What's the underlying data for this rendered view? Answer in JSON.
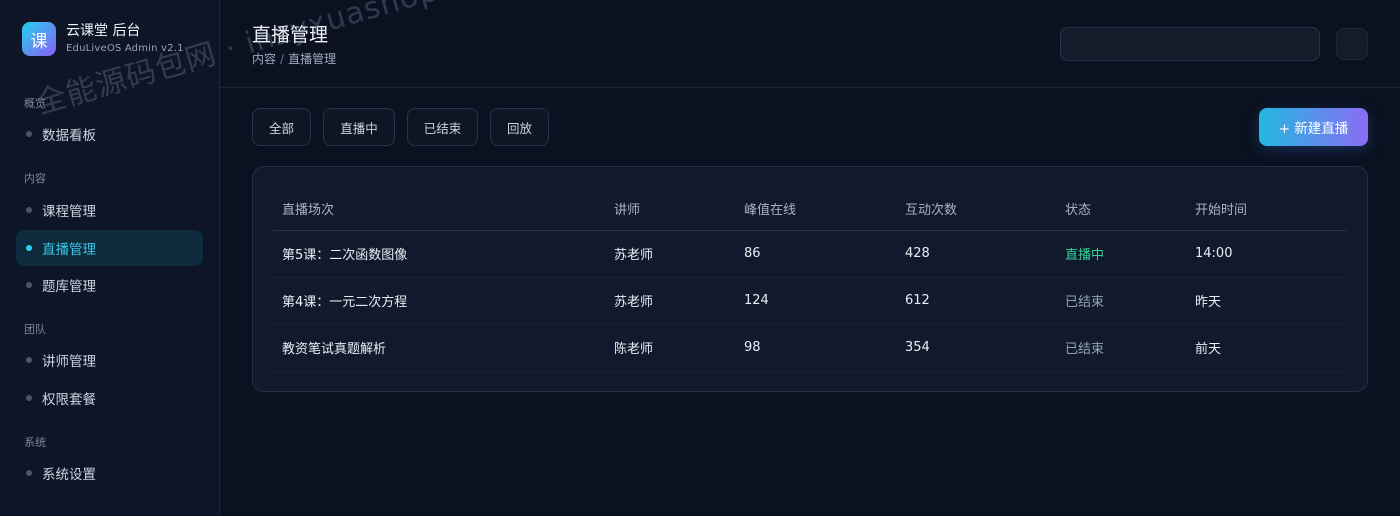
{
  "brand": {
    "logo_char": "课",
    "name": "云课堂 后台",
    "subtitle": "EduLiveOS Admin v2.1"
  },
  "sidebar": {
    "sections": [
      {
        "label": "概览"
      },
      {
        "label": "内容"
      },
      {
        "label": "团队"
      },
      {
        "label": "系统"
      }
    ],
    "items": [
      {
        "label": "数据看板",
        "active": false
      },
      {
        "label": "课程管理",
        "active": false
      },
      {
        "label": "直播管理",
        "active": true
      },
      {
        "label": "题库管理",
        "active": false
      },
      {
        "label": "讲师管理",
        "active": false
      },
      {
        "label": "权限套餐",
        "active": false
      },
      {
        "label": "系统设置",
        "active": false
      }
    ]
  },
  "header": {
    "title": "直播管理",
    "breadcrumb": [
      "内容",
      "直播管理"
    ],
    "breadcrumb_separator": "/",
    "search_value": ""
  },
  "filters": [
    "全部",
    "直播中",
    "已结束",
    "回放"
  ],
  "actions": {
    "new_live_label": "+ 新建直播"
  },
  "table": {
    "columns": [
      "直播场次",
      "讲师",
      "峰值在线",
      "互动次数",
      "状态",
      "开始时间"
    ],
    "rows": [
      {
        "session": "第5课：二次函数图像",
        "teacher": "苏老师",
        "peak_online": "86",
        "interactions": "428",
        "status": "直播中",
        "status_kind": "live",
        "start_time": "14:00"
      },
      {
        "session": "第4课：一元二次方程",
        "teacher": "苏老师",
        "peak_online": "124",
        "interactions": "612",
        "status": "已结束",
        "status_kind": "ended",
        "start_time": "昨天"
      },
      {
        "session": "教资笔试真题解析",
        "teacher": "陈老师",
        "peak_online": "98",
        "interactions": "354",
        "status": "已结束",
        "status_kind": "ended",
        "start_time": "前天"
      }
    ]
  },
  "colors": {
    "accent": "#22d3ee",
    "live_status": "#34d399",
    "brand_gradient_start": "#22d3ee",
    "brand_gradient_end": "#8b5cf6"
  },
  "watermark": "全能源码包网 · inzyxuashop.com"
}
